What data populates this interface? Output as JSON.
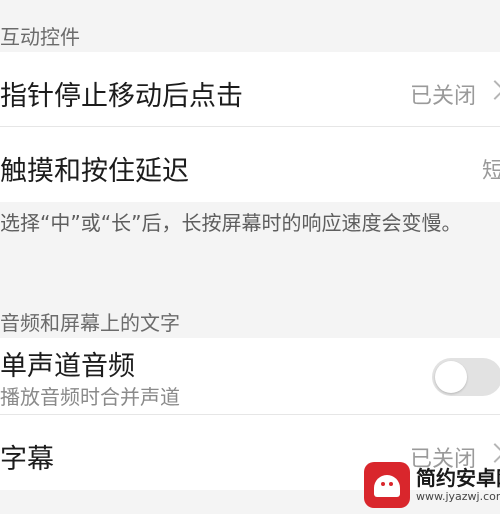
{
  "sections": {
    "interaction_header": "互动控件",
    "audio_header": "音频和屏幕上的文字"
  },
  "rows": {
    "pointer_click": {
      "title": "指针停止移动后点击",
      "value": "已关闭"
    },
    "touch_hold": {
      "title": "触摸和按住延迟",
      "value": "短"
    },
    "touch_hold_note": "选择“中”或“长”后，长按屏幕时的响应速度会变慢。",
    "mono_audio": {
      "title": "单声道音频",
      "subtitle": "播放音频时合并声道",
      "enabled": false
    },
    "captions": {
      "title": "字幕",
      "value": "已关闭"
    }
  },
  "watermark": {
    "name": "简约安卓网",
    "url": "www.jyazwj.com",
    "icon": "android-icon"
  },
  "colors": {
    "background": "#f4f4f4",
    "row_background": "#ffffff",
    "toggle_off": "#e2e2e2",
    "watermark_red": "#d9262c"
  }
}
